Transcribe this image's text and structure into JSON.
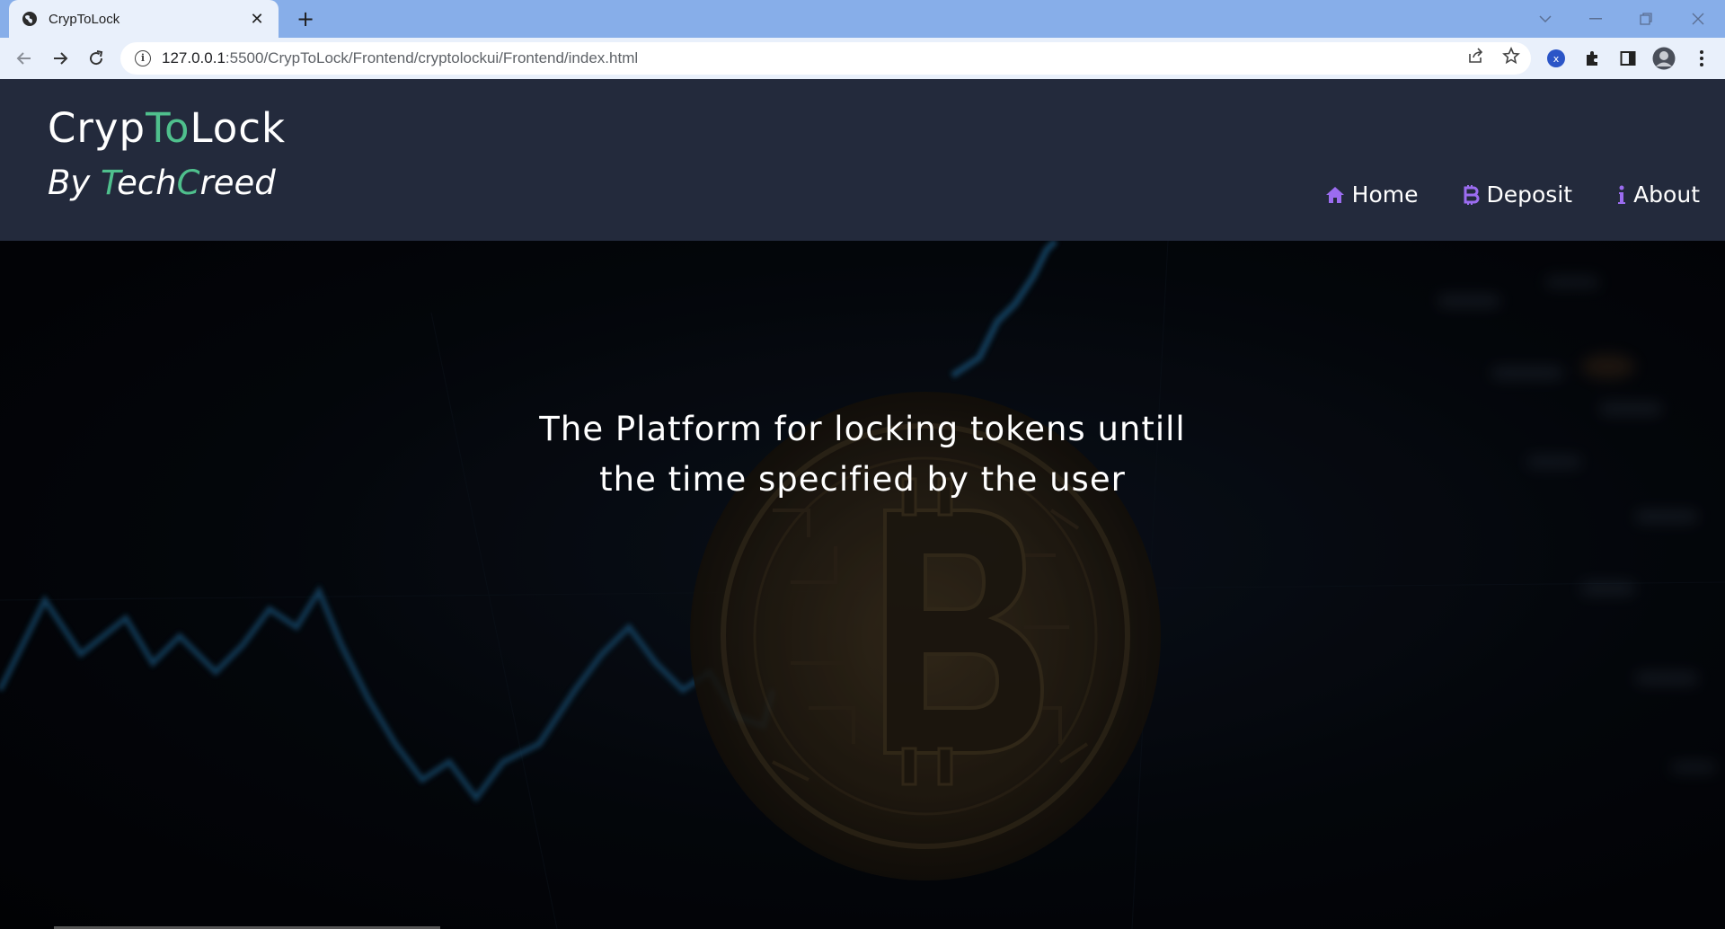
{
  "browser": {
    "tab_title": "CrypToLock",
    "url_host": "127.0.0.1",
    "url_path": ":5500/CrypToLock/Frontend/cryptolockui/Frontend/index.html",
    "extension_badge": "x"
  },
  "site": {
    "brand_part1": "Cryp",
    "brand_part2": "To",
    "brand_part3": "Lock",
    "byline_part1": "By ",
    "byline_part2": "T",
    "byline_part3": "ech",
    "byline_part4": "C",
    "byline_part5": "reed",
    "accent_color": "#4fc08d",
    "nav_icon_color": "#9b6cf0"
  },
  "nav": {
    "items": [
      {
        "label": "Home",
        "icon": "home-icon"
      },
      {
        "label": "Deposit",
        "icon": "bitcoin-icon"
      },
      {
        "label": "About",
        "icon": "info-icon"
      }
    ]
  },
  "hero": {
    "line1": "The Platform for locking tokens untill",
    "line2": "the time specified by the user"
  }
}
